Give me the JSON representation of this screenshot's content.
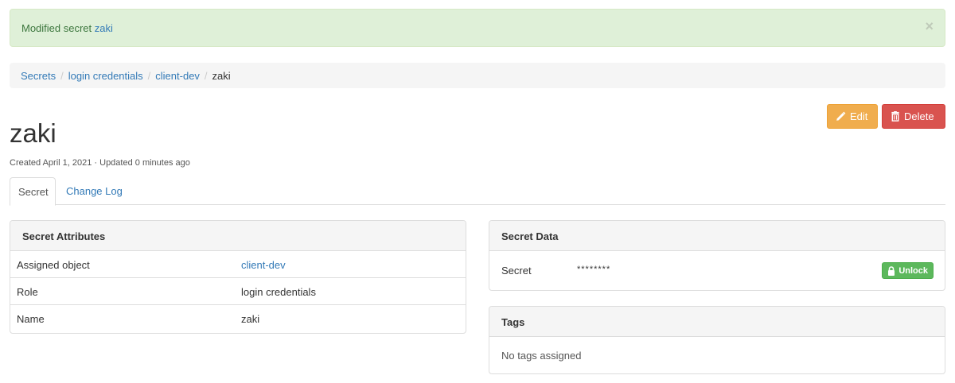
{
  "alert": {
    "prefix": "Modified secret ",
    "link": "zaki",
    "close": "×"
  },
  "breadcrumb": {
    "items": [
      "Secrets",
      "login credentials",
      "client-dev"
    ],
    "current": "zaki",
    "separator": "/"
  },
  "actions": {
    "edit": "Edit",
    "delete": "Delete"
  },
  "title": "zaki",
  "meta": "Created April 1, 2021 · Updated 0 minutes ago",
  "tabs": [
    "Secret",
    "Change Log"
  ],
  "attributes": {
    "heading": "Secret Attributes",
    "rows": [
      {
        "label": "Assigned object",
        "value": "client-dev"
      },
      {
        "label": "Role",
        "value": "login credentials"
      },
      {
        "label": "Name",
        "value": "zaki"
      }
    ]
  },
  "secret_data": {
    "heading": "Secret Data",
    "label": "Secret",
    "value": "********",
    "unlock": "Unlock"
  },
  "tags": {
    "heading": "Tags",
    "empty": "No tags assigned"
  },
  "colors": {
    "success_bg": "#dff0d8",
    "link": "#337ab7",
    "edit": "#f0ad4e",
    "delete": "#d9534f",
    "unlock": "#5cb85c"
  }
}
